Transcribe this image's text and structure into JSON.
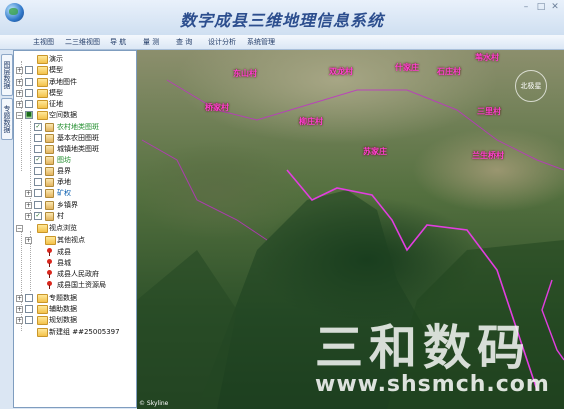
{
  "app": {
    "title": "数字成县三维地理信息系统"
  },
  "menu": [
    "主视图",
    "二三维视图",
    "导 航",
    "量 测",
    "查 询",
    "设计分析",
    "系统管理"
  ],
  "side_tabs": [
    "图层数据",
    "专题数据"
  ],
  "tree": [
    {
      "label": "演示",
      "color": "normal"
    },
    {
      "label": "模型",
      "color": "normal"
    },
    {
      "label": "承地图件",
      "color": "normal"
    },
    {
      "label": "模型",
      "color": "normal"
    },
    {
      "label": "征地",
      "color": "normal"
    },
    {
      "label": "空间数据",
      "color": "normal"
    },
    {
      "label": "农村地类图斑",
      "color": "green"
    },
    {
      "label": "基本农田图斑",
      "color": "normal"
    },
    {
      "label": "城镇地类图斑",
      "color": "normal"
    },
    {
      "label": "图坊",
      "color": "green"
    },
    {
      "label": "县界",
      "color": "normal"
    },
    {
      "label": "承地",
      "color": "normal"
    },
    {
      "label": "矿权",
      "color": "blue"
    },
    {
      "label": "乡镇界",
      "color": "normal"
    },
    {
      "label": "村",
      "color": "normal"
    },
    {
      "label": "视点浏览",
      "color": "normal"
    },
    {
      "label": "其他视点",
      "color": "normal"
    },
    {
      "label": "成县",
      "color": "normal"
    },
    {
      "label": "县城",
      "color": "normal"
    },
    {
      "label": "成县人民政府",
      "color": "normal"
    },
    {
      "label": "成县国土资源局",
      "color": "normal"
    },
    {
      "label": "专题数据",
      "color": "normal"
    },
    {
      "label": "辅助数据",
      "color": "normal"
    },
    {
      "label": "规划数据",
      "color": "normal"
    },
    {
      "label": "新建组 ##25005397",
      "color": "normal"
    }
  ],
  "map": {
    "places": [
      "东山村",
      "双龙村",
      "什家庄",
      "石庄村",
      "苇水村",
      "柳庄村",
      "苏家庄",
      "三里村",
      "桥家村",
      "兰生桥村"
    ],
    "compass": "北极星",
    "watermark": "三和数码",
    "watermark_url": "www.shsmch.com",
    "credit": "© Skyline",
    "boundary_color": "#e23ee0"
  }
}
